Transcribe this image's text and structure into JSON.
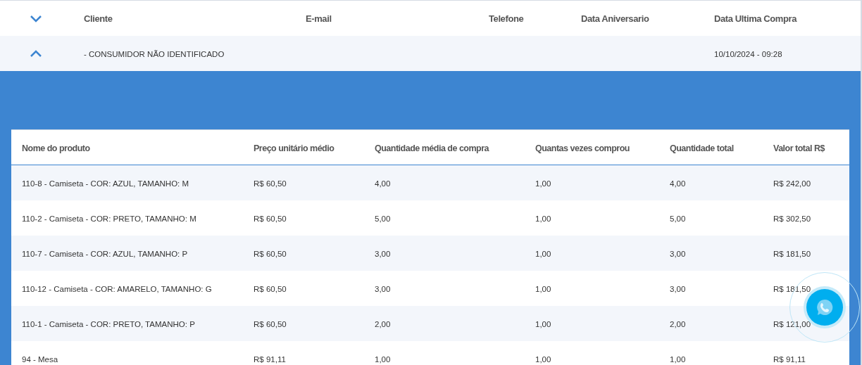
{
  "customers_table": {
    "columns": [
      "Cliente",
      "E-mail",
      "Telefone",
      "Data Aniversario",
      "Data Ultima Compra"
    ],
    "rows": [
      {
        "expanded": true,
        "cells": [
          "- CONSUMIDOR NÃO IDENTIFICADO",
          "",
          "",
          "",
          "10/10/2024 - 09:28"
        ]
      }
    ]
  },
  "products_table": {
    "columns": [
      "Nome do produto",
      "Preço unitário médio",
      "Quantidade média de compra",
      "Quantas vezes comprou",
      "Quantidade total",
      "Valor total R$"
    ],
    "rows": [
      [
        "110-8 - Camiseta - COR: AZUL, TAMANHO: M",
        "R$ 60,50",
        "4,00",
        "1,00",
        "4,00",
        "R$ 242,00"
      ],
      [
        "110-2 - Camiseta - COR: PRETO, TAMANHO: M",
        "R$ 60,50",
        "5,00",
        "1,00",
        "5,00",
        "R$ 302,50"
      ],
      [
        "110-7 - Camiseta - COR: AZUL, TAMANHO: P",
        "R$ 60,50",
        "3,00",
        "1,00",
        "3,00",
        "R$ 181,50"
      ],
      [
        "110-12 - Camiseta - COR: AMARELO, TAMANHO: G",
        "R$ 60,50",
        "3,00",
        "1,00",
        "3,00",
        "R$ 181,50"
      ],
      [
        "110-1 - Camiseta - COR: PRETO, TAMANHO: P",
        "R$ 60,50",
        "2,00",
        "1,00",
        "2,00",
        "R$ 121,00"
      ],
      [
        "94 - Mesa",
        "R$ 91,11",
        "1,00",
        "1,00",
        "1,00",
        "R$ 91,11"
      ]
    ]
  }
}
